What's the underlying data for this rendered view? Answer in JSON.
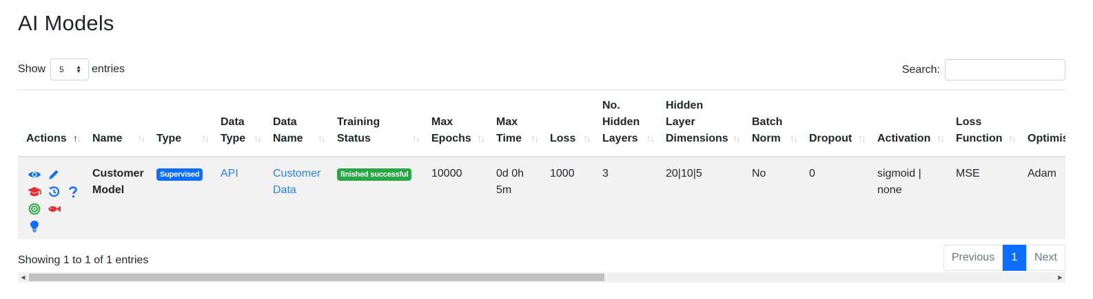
{
  "page": {
    "title": "AI Models"
  },
  "length_menu": {
    "show_label": "Show",
    "value": "5",
    "entries_label": "entries"
  },
  "search": {
    "label": "Search:",
    "value": ""
  },
  "table": {
    "columns": [
      "Actions",
      "Name",
      "Type",
      "Data Type",
      "Data Name",
      "Training Status",
      "Max Epochs",
      "Max Time",
      "Loss",
      "No. Hidden Layers",
      "Hidden Layer Dimensions",
      "Batch Norm",
      "Dropout",
      "Activation",
      "Loss Function",
      "Optimiser"
    ],
    "rows": [
      {
        "name": "Customer Model",
        "type": "Supervised",
        "data_type": "API",
        "data_name": "Customer Data",
        "training_status": "finished successful",
        "max_epochs": "10000",
        "max_time": "0d 0h 5m",
        "loss": "1000",
        "hidden_layers": "3",
        "hidden_dims": "20|10|5",
        "batch_norm": "No",
        "dropout": "0",
        "activation": "sigmoid | none",
        "loss_function": "MSE",
        "optimiser": "Adam",
        "actions": [
          "eye-icon",
          "pencil-icon",
          "graduation-cap-icon",
          "history-icon",
          "question-icon",
          "bullseye-icon",
          "fish-icon",
          "lightbulb-icon"
        ]
      }
    ]
  },
  "info": "Showing 1 to 1 of 1 entries",
  "pagination": {
    "previous": "Previous",
    "current": "1",
    "next": "Next"
  },
  "colors": {
    "primary": "#0d6efd",
    "success": "#28a745",
    "danger": "#e03131",
    "link": "#2f7fde",
    "row_bg": "#f2f2f2"
  }
}
